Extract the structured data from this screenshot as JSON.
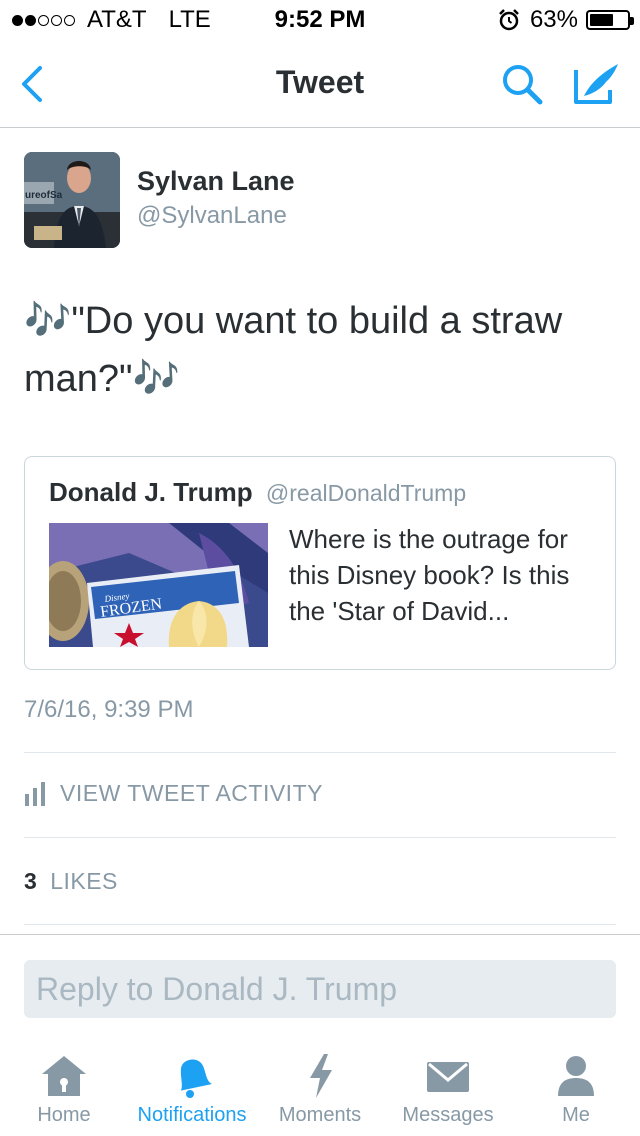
{
  "status_bar": {
    "carrier": "AT&T",
    "network": "LTE",
    "time": "9:52 PM",
    "battery": "63%",
    "battery_level": 0.63,
    "signal_bars": 2
  },
  "nav": {
    "title": "Tweet",
    "back_icon": "chevron-left-icon",
    "search_icon": "search-icon",
    "compose_icon": "compose-icon"
  },
  "tweet": {
    "author_name": "Sylvan Lane",
    "author_handle": "@SylvanLane",
    "text": "🎶\"Do you want to build a straw man?\"🎶",
    "timestamp": "7/6/16, 9:39 PM"
  },
  "quote": {
    "author_name": "Donald J. Trump",
    "author_handle": "@realDonaldTrump",
    "text": "Where is the outrage for this Disney book? Is this the 'Star of David...",
    "image_caption_logo": "Disney",
    "image_caption_title": "FROZEN"
  },
  "activity": {
    "label": "VIEW TWEET ACTIVITY"
  },
  "likes": {
    "count": "3",
    "label": "LIKES"
  },
  "reply": {
    "placeholder": "Reply to Donald J. Trump"
  },
  "tab_bar": {
    "items": [
      {
        "label": "Home",
        "icon": "home-icon"
      },
      {
        "label": "Notifications",
        "icon": "bell-icon"
      },
      {
        "label": "Moments",
        "icon": "lightning-icon"
      },
      {
        "label": "Messages",
        "icon": "envelope-icon"
      },
      {
        "label": "Me",
        "icon": "person-icon"
      }
    ],
    "active": "Notifications"
  },
  "colors": {
    "accent": "#1da1f2",
    "text": "#292f33",
    "secondary": "#8899a6",
    "divider": "#e1e8ed"
  }
}
